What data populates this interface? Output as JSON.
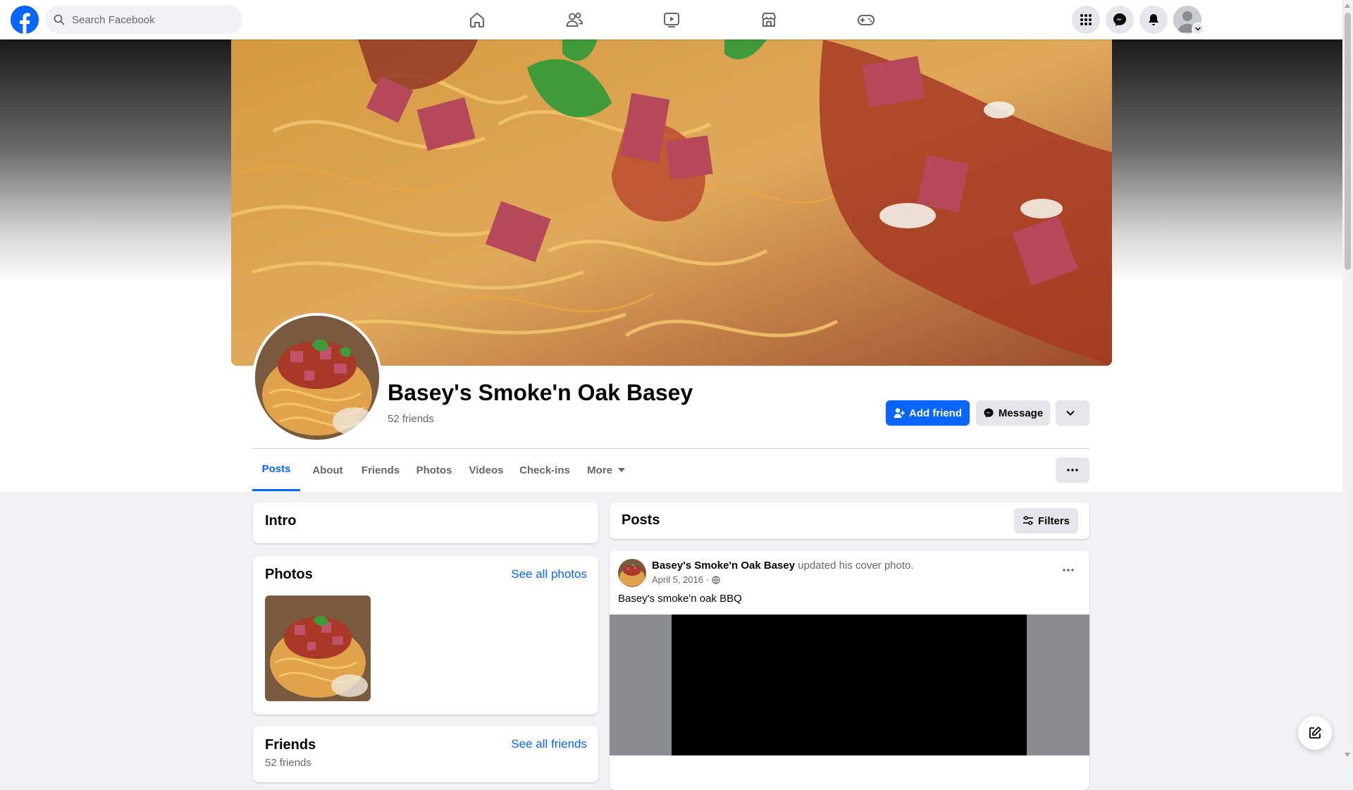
{
  "nav": {
    "search_placeholder": "Search Facebook",
    "tabs": [
      "home-icon",
      "friends-icon",
      "watch-icon",
      "marketplace-icon",
      "gaming-icon"
    ],
    "right_buttons": [
      "menu-grid-icon",
      "messenger-icon",
      "notifications-icon",
      "account-avatar"
    ]
  },
  "profile": {
    "name": "Basey's Smoke'n Oak Basey",
    "friends": "52 friends",
    "add_friend_label": "Add friend",
    "message_label": "Message"
  },
  "tabs": [
    {
      "label": "Posts",
      "active": true
    },
    {
      "label": "About"
    },
    {
      "label": "Friends"
    },
    {
      "label": "Photos"
    },
    {
      "label": "Videos"
    },
    {
      "label": "Check-ins"
    },
    {
      "label": "More"
    }
  ],
  "intro": {
    "title": "Intro"
  },
  "photos": {
    "title": "Photos",
    "link": "See all photos"
  },
  "friends_card": {
    "title": "Friends",
    "link": "See all friends",
    "count": "52 friends"
  },
  "posts": {
    "title": "Posts",
    "filters_label": "Filters",
    "items": [
      {
        "author": "Basey's Smoke'n Oak Basey",
        "action": "updated his cover photo.",
        "date": "April 5, 2016",
        "privacy": "globe-icon",
        "text": "Basey's smoke'n oak BBQ"
      }
    ]
  },
  "colors": {
    "brand": "#0866ff",
    "page_bg": "#f0f2f5",
    "secondary_text": "#65676b"
  }
}
